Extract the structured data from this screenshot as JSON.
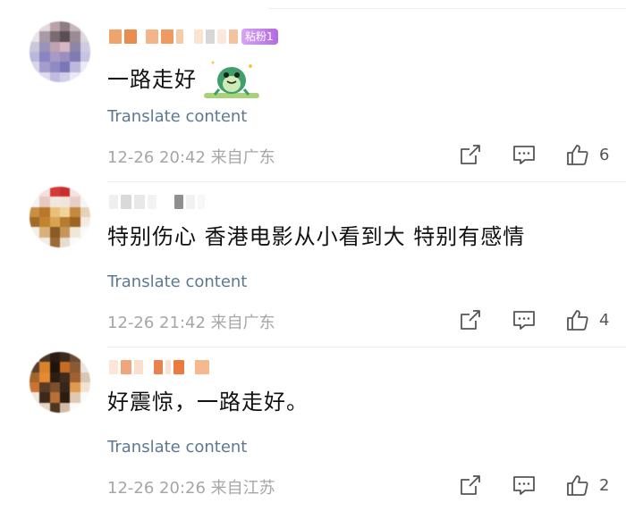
{
  "comments": [
    {
      "fan_badge": "粘粉1",
      "text": "一路走好",
      "has_sticker": true,
      "translate": "Translate content",
      "meta": "12-26 20:42 来自广东",
      "likes": "6"
    },
    {
      "fan_badge": "",
      "text": "特别伤心 香港电影从小看到大 特别有感情",
      "has_sticker": false,
      "translate": "Translate content",
      "meta": "12-26 21:42 来自广东",
      "likes": "4"
    },
    {
      "fan_badge": "",
      "text": "好震惊，一路走好。",
      "has_sticker": false,
      "translate": "Translate content",
      "meta": "12-26 20:26 来自江苏",
      "likes": "2"
    }
  ],
  "icons": {
    "share": "share-icon",
    "comment": "comment-icon",
    "like": "thumbs-up-icon"
  },
  "colors": {
    "translate_link": "#5d7894",
    "meta_text": "#a6a6a6",
    "fan_badge": "#b36ae0"
  }
}
